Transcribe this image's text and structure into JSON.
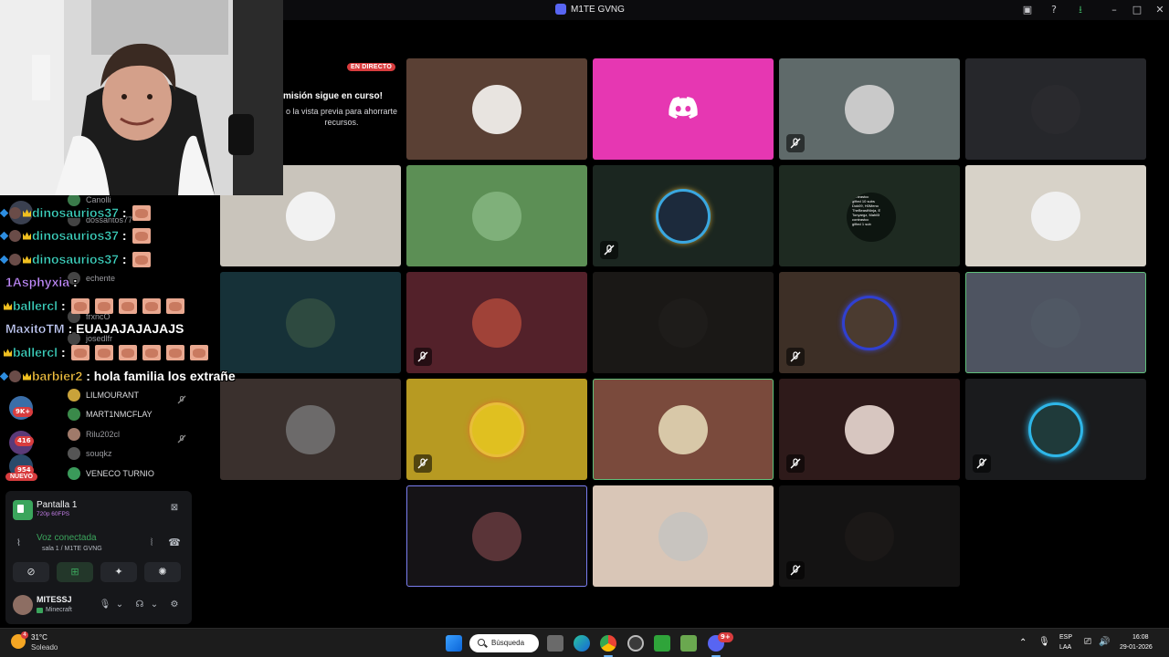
{
  "window": {
    "title": "M1TE GVNG"
  },
  "live": {
    "badge": "EN DIRECTO",
    "title": "misión sigue en curso!",
    "subtitle": "o la vista previa para ahorrarte recursos."
  },
  "tiles": [
    {
      "bg": "#5a4034",
      "avatar": "#e8e4e0",
      "muted": false
    },
    {
      "bg": "#e637b2",
      "discord": true,
      "muted": false
    },
    {
      "bg": "#5f6a6a",
      "avatar": "#c9c9c9",
      "muted": true
    },
    {
      "bg": "#26272b",
      "avatar": "#2a2a2e",
      "muted": false
    },
    {
      "bg": "#c9c4bb",
      "avatar": "#f2f2f2",
      "muted": false
    },
    {
      "bg": "#5c8f55",
      "avatar": "#7fb07a",
      "muted": false
    },
    {
      "bg": "#1b2620",
      "avatar": "#1c2a3c",
      "muted": true
    },
    {
      "bg": "#1e2a21",
      "text": true,
      "muted": false
    },
    {
      "bg": "#d7d2c8",
      "avatar": "#f0f0f0",
      "muted": false
    },
    {
      "bg": "#163138",
      "avatar": "#2e4a40",
      "muted": false
    },
    {
      "bg": "#53212a",
      "avatar": "#a04238",
      "muted": true
    },
    {
      "bg": "#1a1816",
      "avatar": "#1e1c1a",
      "muted": false
    },
    {
      "bg": "#3d2f26",
      "avatar": "#4b3b30",
      "muted": true
    },
    {
      "bg": "#4e5461",
      "avatar": "#505864",
      "muted": false
    },
    {
      "bg": "#3a302d",
      "avatar": "#6c6a6a",
      "muted": false
    },
    {
      "bg": "#b79a22",
      "avatar": "#e0c020",
      "muted": true
    },
    {
      "bg": "#7a4a3c",
      "avatar": "#d8c8a8",
      "muted": false
    },
    {
      "bg": "#2e1a1a",
      "avatar": "#d7c6c0",
      "muted": true
    },
    {
      "bg": "#1a1b1d",
      "avatar": "#1f3a3a",
      "muted": true
    },
    {
      "bg": "#151316",
      "avatar": "#5a3438",
      "muted": false
    },
    {
      "bg": "#d9c6b7",
      "avatar": "#c8c4bf",
      "muted": false
    },
    {
      "bg": "#141313",
      "avatar": "#1b1817",
      "muted": true
    }
  ],
  "textcard": {
    "lines": [
      "contrastcc",
      "gifted 10 subs",
      "Dok09, H0Meno",
      "TheBeastNinja, E",
      "Tonyargz, Mahi0l",
      "contrastcc",
      "gifted 1 sub"
    ]
  },
  "chat": [
    {
      "name": "dinosaurios37",
      "color": "#3ed6c2",
      "msg": ":"
    },
    {
      "name": "dinosaurios37",
      "color": "#3ed6c2",
      "msg": ":"
    },
    {
      "name": "dinosaurios37",
      "color": "#3ed6c2",
      "msg": ":"
    },
    {
      "name": "1Asphyxia",
      "color": "#c38cff",
      "msg": ":"
    },
    {
      "name": "ballercl",
      "color": "#3ed6c2",
      "msg": ":"
    },
    {
      "name": "MaxitoTM",
      "color": "#c9d2ff",
      "msg": ": EUAJAJAJAJAJS"
    },
    {
      "name": "ballercl",
      "color": "#3ed6c2",
      "msg": ":"
    },
    {
      "name": "barbier2",
      "color": "#f0c040",
      "msg": ": hola familia los extrañe"
    }
  ],
  "members_behind": [
    {
      "name": "Canolli",
      "dim": true
    },
    {
      "name": "dossantos77",
      "dim": true
    },
    {
      "name": "echente",
      "dim": true
    },
    {
      "name": "frxncO",
      "dim": true
    },
    {
      "name": "josedlfr",
      "dim": true
    },
    {
      "name": "LILMOURANT",
      "dim": false
    },
    {
      "name": "MART1NMCFLAY",
      "dim": false
    },
    {
      "name": "Rilu202cl",
      "dim": true
    },
    {
      "name": "souqkz",
      "dim": true
    },
    {
      "name": "VENECO TURNIO",
      "dim": false
    }
  ],
  "servers": {
    "badge1": "9K+",
    "badge2": "416",
    "badge3": "954",
    "new": "NUEVO"
  },
  "panel": {
    "screen_title": "Pantalla 1",
    "screen_sub": "720p 60FPS",
    "voice_title": "Voz conectada",
    "voice_sub": "sala 1 / M1TE GVNG",
    "user_name": "MITESSJ",
    "user_status": "Minecraft"
  },
  "taskbar": {
    "temp": "31°C",
    "condition": "Soleado",
    "search": "Búsqueda",
    "lang1": "ESP",
    "lang2": "LAA",
    "time": "16:08",
    "date": "29-01-2026",
    "weather_badge": "4",
    "discord_badge": "9+"
  },
  "colors": {
    "accent_green": "#3ba55c",
    "live_red": "#d83c3e",
    "discord_blurple": "#5865f2"
  }
}
